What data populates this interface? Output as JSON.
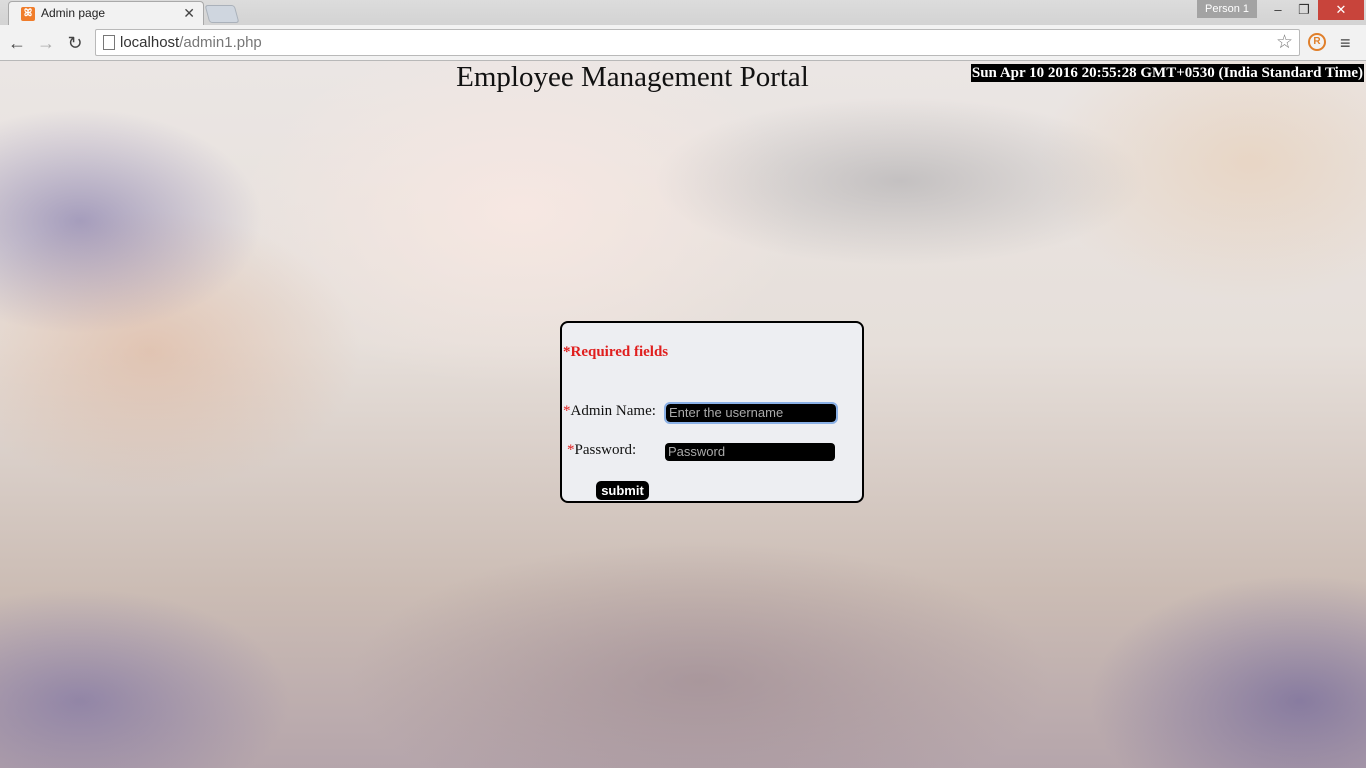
{
  "browser": {
    "tab_title": "Admin page",
    "tab_close": "✕",
    "profile_label": "Person 1",
    "window_controls": {
      "minimize": "–",
      "maximize": "❐",
      "close": "✕"
    },
    "nav": {
      "back": "←",
      "forward": "→",
      "reload": "↻"
    },
    "url_host": "localhost",
    "url_path": "/admin1.php",
    "bookmark_star": "☆",
    "extension_icon": "R",
    "menu_icon": "≡"
  },
  "page": {
    "title": "Employee Management Portal",
    "clock": "Sun Apr 10 2016 20:55:28 GMT+0530 (India Standard Time)"
  },
  "form": {
    "required_note": "*Required fields",
    "required_marker": "*",
    "admin_name_label": "Admin Name:",
    "admin_name_placeholder": "Enter the username",
    "password_label": "Password:",
    "password_placeholder": "Password",
    "submit_label": "submit"
  },
  "colors": {
    "required_red": "#e01e1e",
    "field_bg": "#000000",
    "box_bg": "#edeef2",
    "close_button": "#c8443b"
  }
}
